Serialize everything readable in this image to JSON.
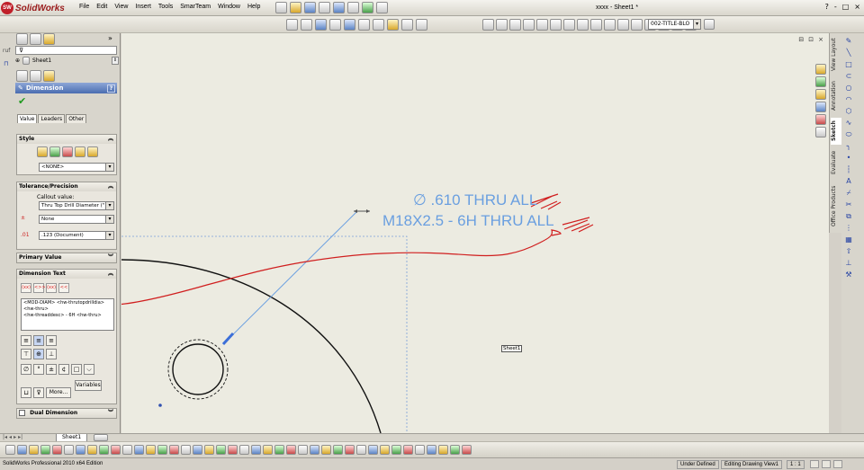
{
  "app": {
    "logo_text": "SolidWorks",
    "logo_mark": "SW",
    "doc_title": "xxxx - Sheet1 *",
    "menus": [
      "File",
      "Edit",
      "View",
      "Insert",
      "Tools",
      "SmarTeam",
      "Window",
      "Help"
    ],
    "window_controls": [
      "?",
      "-",
      "□",
      "×"
    ]
  },
  "toolbar2": {
    "sheet_format_value": "002-TITLE-BLO"
  },
  "left_panel": {
    "filter_icon": "funnel-icon",
    "sheet_row_label": "Sheet1",
    "strip_label": "ruf",
    "pm_title": "Dimension",
    "pm_help": "?",
    "tabs": [
      "Value",
      "Leaders",
      "Other"
    ],
    "style": {
      "title": "Style",
      "dropdown_value": "<NONE>"
    },
    "tolerance": {
      "title": "Tolerance/Precision",
      "callout_label": "Callout value:",
      "callout_value": "Thru Top Drill Diameter (\"",
      "tolerance_value": "None",
      "precision_value": ".123 (Document)"
    },
    "primary_value": {
      "title": "Primary Value"
    },
    "dimension_text": {
      "title": "Dimension Text",
      "buttons": [
        "(xx)",
        "<>>",
        "(xx)",
        "<<"
      ],
      "text": "<MOD-DIAM> <hw-thrutopdrilldia> <hw-thru>\n<hw-threaddesc> - 6H <hw-thru>",
      "more_label": "More...",
      "variables_label": "Variables",
      "symbols": [
        "∅",
        "°",
        "±",
        "¢",
        "□",
        "⌵"
      ]
    },
    "dual_dimension": {
      "title": "Dual Dimension"
    }
  },
  "canvas": {
    "note_line1": "∅ .610 THRU ALL",
    "note_line2": "M18X2.5  - 6H THRU ALL",
    "sheet_label": "Sheet1",
    "controls": [
      "⊟",
      "⊡",
      "×"
    ]
  },
  "right_tabs": [
    "View Layout",
    "Annotation",
    "Sketch",
    "Evaluate",
    "Office Products"
  ],
  "sheet_tabs": {
    "nav": [
      "|◂",
      "◂",
      "▸",
      "▸|"
    ],
    "active": "Sheet1"
  },
  "statusbar": {
    "app_edition": "SolidWorks Professional 2010 x64 Edition",
    "defined_state": "Under Defined",
    "editing_state": "Editing Drawing View1",
    "scale": "1 : 1"
  },
  "colors": {
    "note_blue": "#6a9fe0",
    "markup_red": "#d01e1e",
    "geometry_black": "#111111",
    "accent_header": "#4a6db0"
  }
}
